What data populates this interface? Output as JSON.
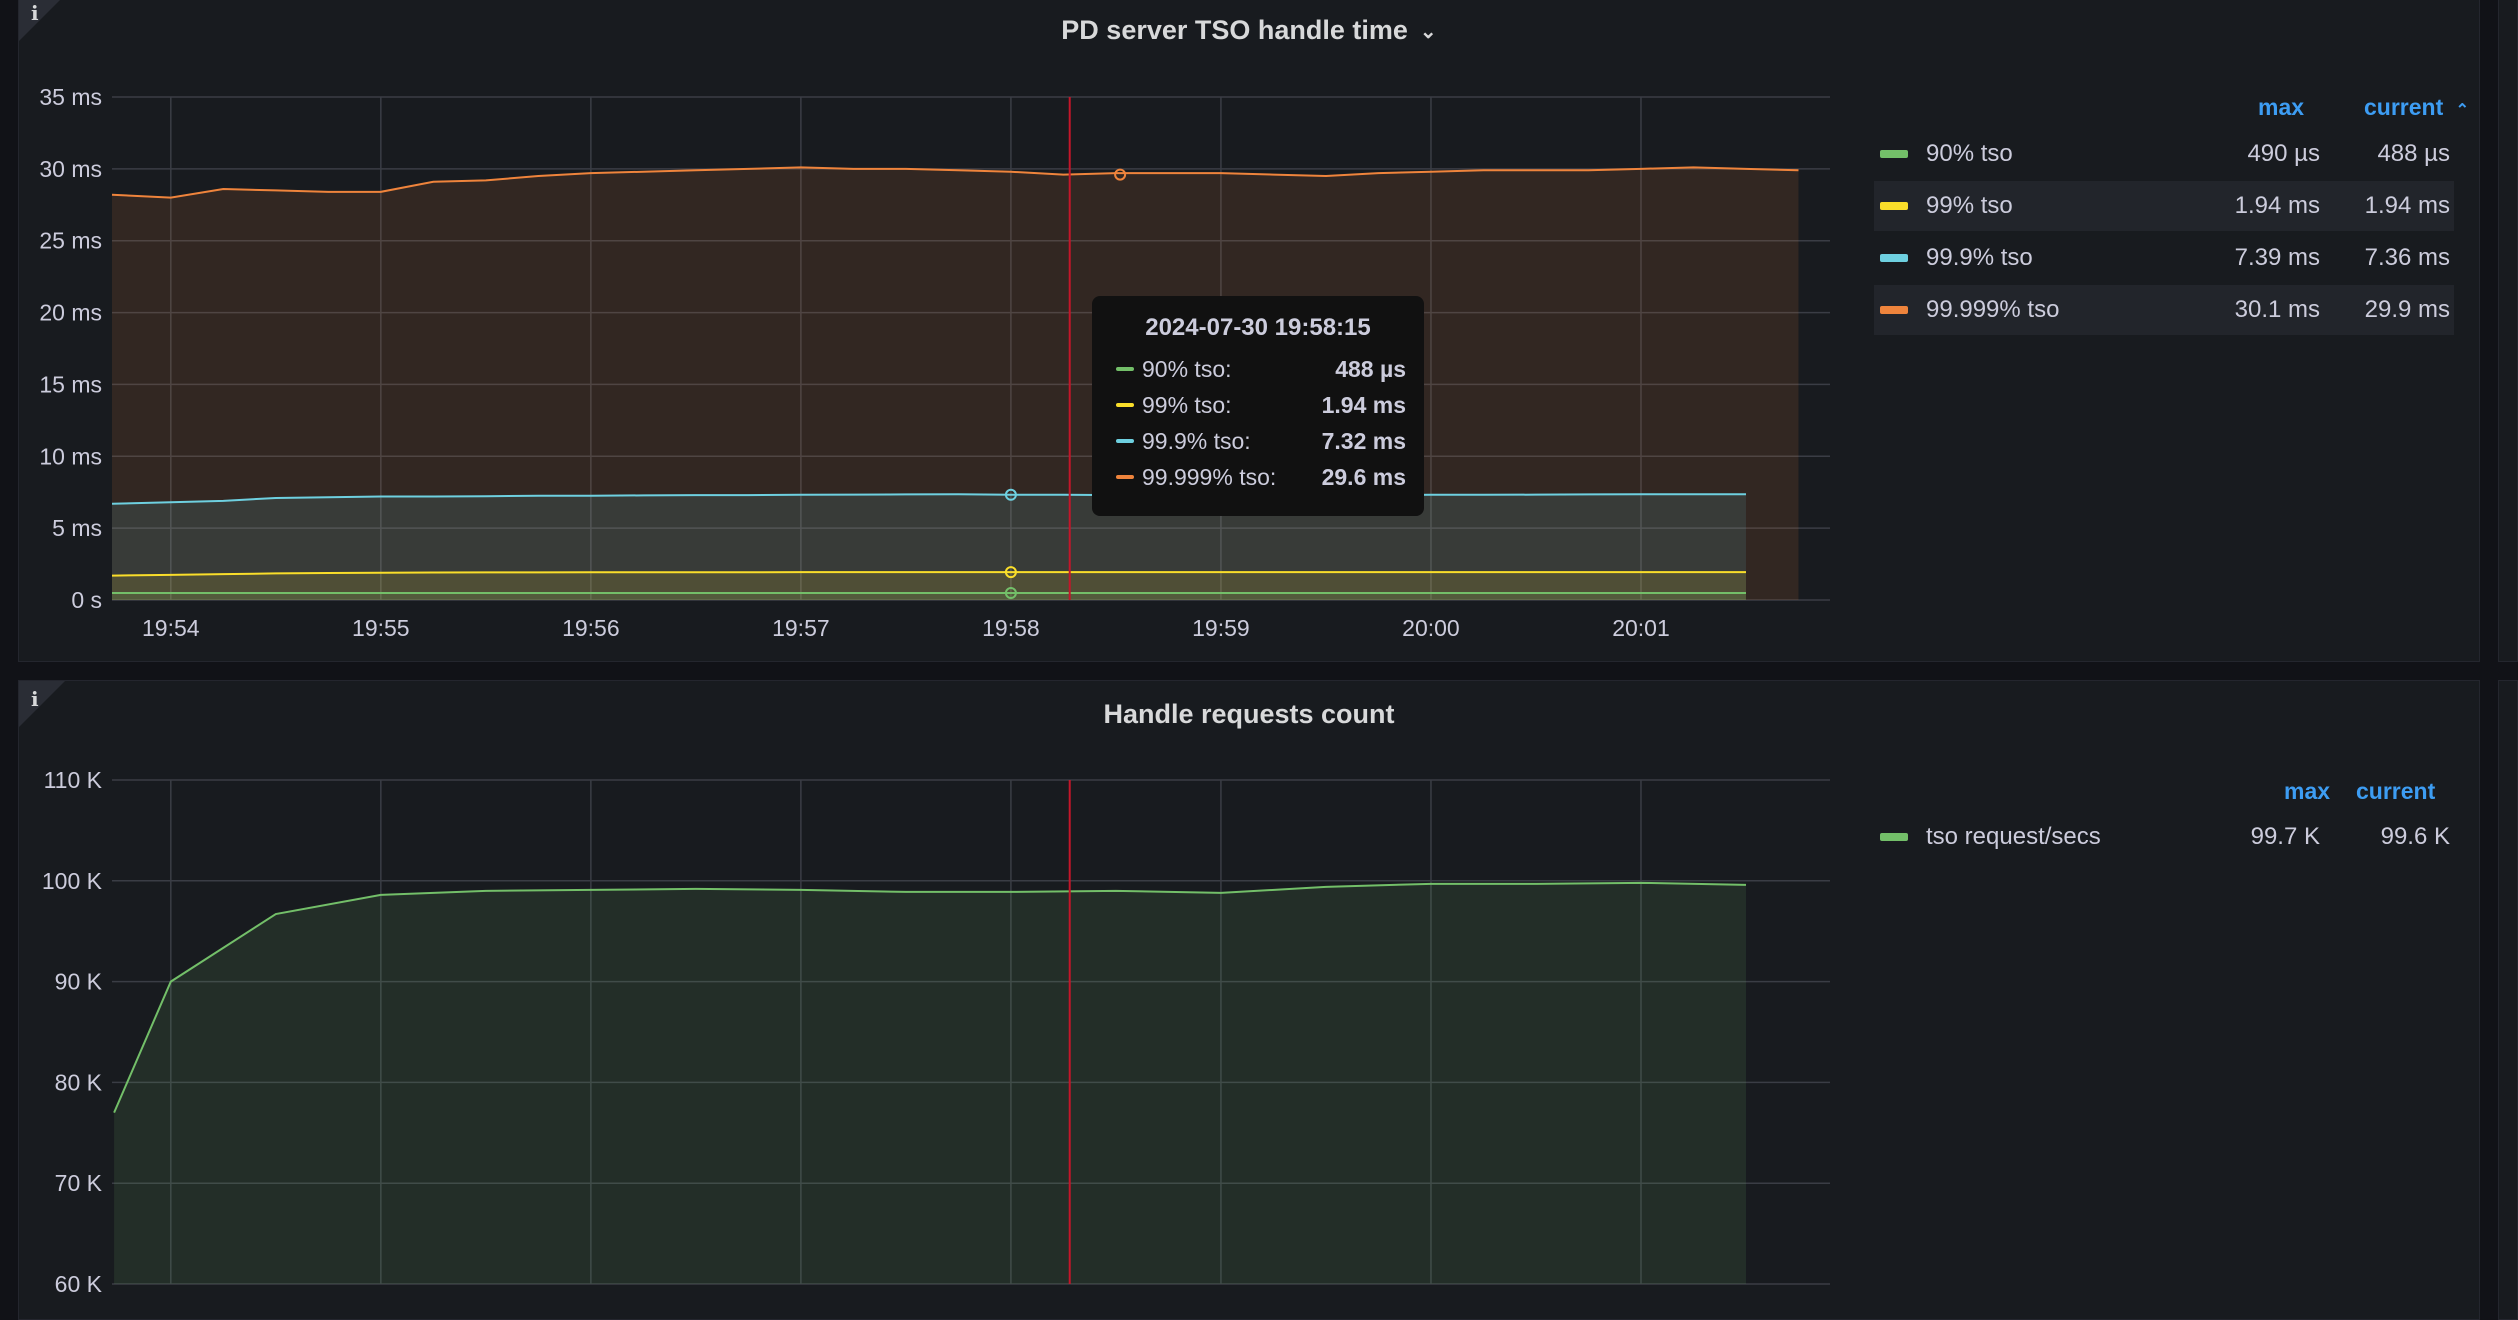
{
  "panel1": {
    "title": "PD server TSO handle time",
    "info_icon": "i",
    "legend": {
      "max_label": "max",
      "current_label": "current",
      "rows": [
        {
          "name": "90% tso",
          "max": "490 µs",
          "current": "488 µs",
          "color": "#73bf69"
        },
        {
          "name": "99% tso",
          "max": "1.94 ms",
          "current": "1.94 ms",
          "color": "#fade2a"
        },
        {
          "name": "99.9% tso",
          "max": "7.39 ms",
          "current": "7.36 ms",
          "color": "#6ed0e0"
        },
        {
          "name": "99.999% tso",
          "max": "30.1 ms",
          "current": "29.9 ms",
          "color": "#ef843c"
        }
      ]
    },
    "tooltip": {
      "time": "2024-07-30 19:58:15",
      "rows": [
        {
          "label": "90% tso:",
          "value": "488 µs",
          "color": "#73bf69"
        },
        {
          "label": "99% tso:",
          "value": "1.94 ms",
          "color": "#fade2a"
        },
        {
          "label": "99.9% tso:",
          "value": "7.32 ms",
          "color": "#6ed0e0"
        },
        {
          "label": "99.999% tso:",
          "value": "29.6 ms",
          "color": "#ef843c"
        }
      ]
    }
  },
  "panel2": {
    "title": "Handle requests count",
    "info_icon": "i",
    "legend": {
      "max_label": "max",
      "current_label": "current",
      "rows": [
        {
          "name": "tso request/secs",
          "max": "99.7 K",
          "current": "99.6 K",
          "color": "#73bf69"
        }
      ]
    }
  },
  "chart_data": [
    {
      "type": "area",
      "title": "PD server TSO handle time",
      "ylim": [
        0,
        35
      ],
      "y_ticks": [
        "35 ms",
        "30 ms",
        "25 ms",
        "20 ms",
        "15 ms",
        "10 ms",
        "5 ms",
        "0 s"
      ],
      "y_tick_values": [
        35,
        30,
        25,
        20,
        15,
        10,
        5,
        0
      ],
      "x_ticks": [
        "19:54",
        "19:55",
        "19:56",
        "19:57",
        "19:58",
        "19:59",
        "20:00",
        "20:01"
      ],
      "x_tick_minutes": [
        0,
        1,
        2,
        3,
        4,
        5,
        6,
        7
      ],
      "xlim_minutes": [
        -0.28,
        7.9
      ],
      "cursor_minute": 4.28,
      "x_minutes": [
        -0.28,
        0,
        0.25,
        0.5,
        0.75,
        1,
        1.25,
        1.5,
        1.75,
        2,
        2.25,
        2.5,
        2.75,
        3,
        3.25,
        3.5,
        3.75,
        4,
        4.25,
        4.5,
        4.75,
        5,
        5.25,
        5.5,
        5.75,
        6,
        6.25,
        6.5,
        6.75,
        7,
        7.25,
        7.5,
        7.75
      ],
      "series": [
        {
          "name": "90% tso",
          "color": "#73bf69",
          "values": [
            0.49,
            0.49,
            0.49,
            0.49,
            0.49,
            0.49,
            0.49,
            0.49,
            0.49,
            0.49,
            0.49,
            0.49,
            0.49,
            0.49,
            0.49,
            0.49,
            0.49,
            0.488,
            0.488,
            0.488,
            0.488,
            0.488,
            0.488,
            0.488,
            0.488,
            0.488,
            0.488,
            0.488,
            0.488,
            0.488,
            0.488,
            0.488,
            null
          ]
        },
        {
          "name": "99% tso",
          "color": "#fade2a",
          "values": [
            1.7,
            1.75,
            1.8,
            1.85,
            1.88,
            1.9,
            1.91,
            1.92,
            1.92,
            1.93,
            1.93,
            1.93,
            1.93,
            1.94,
            1.94,
            1.94,
            1.94,
            1.94,
            1.94,
            1.94,
            1.94,
            1.94,
            1.94,
            1.94,
            1.94,
            1.94,
            1.94,
            1.94,
            1.94,
            1.94,
            1.94,
            1.94,
            null
          ]
        },
        {
          "name": "99.9% tso",
          "color": "#6ed0e0",
          "values": [
            6.7,
            6.8,
            6.9,
            7.1,
            7.15,
            7.2,
            7.2,
            7.22,
            7.25,
            7.25,
            7.28,
            7.3,
            7.3,
            7.32,
            7.33,
            7.35,
            7.36,
            7.32,
            7.32,
            7.3,
            7.3,
            7.3,
            7.28,
            7.3,
            7.3,
            7.32,
            7.32,
            7.33,
            7.35,
            7.36,
            7.36,
            7.36,
            null
          ]
        },
        {
          "name": "99.999% tso",
          "color": "#ef843c",
          "values": [
            28.2,
            28.0,
            28.6,
            28.5,
            28.4,
            28.4,
            29.1,
            29.2,
            29.5,
            29.7,
            29.8,
            29.9,
            30.0,
            30.1,
            30.0,
            30.0,
            29.9,
            29.8,
            29.6,
            29.7,
            29.7,
            29.7,
            29.6,
            29.5,
            29.7,
            29.8,
            29.9,
            29.9,
            29.9,
            30.0,
            30.1,
            30.0,
            29.9
          ]
        }
      ]
    },
    {
      "type": "area",
      "title": "Handle requests count",
      "ylim": [
        60,
        110
      ],
      "y_ticks": [
        "110 K",
        "100 K",
        "90 K",
        "80 K",
        "70 K",
        "60 K"
      ],
      "y_tick_values": [
        110,
        100,
        90,
        80,
        70,
        60
      ],
      "x_tick_minutes": [
        0,
        1,
        2,
        3,
        4,
        5,
        6,
        7
      ],
      "xlim_minutes": [
        -0.28,
        7.9
      ],
      "cursor_minute": 4.28,
      "x_minutes": [
        -0.27,
        0,
        0.5,
        1,
        1.5,
        2,
        2.5,
        3,
        3.5,
        4,
        4.5,
        5,
        5.5,
        6,
        6.5,
        7,
        7.5
      ],
      "series": [
        {
          "name": "tso request/secs",
          "color": "#73bf69",
          "values": [
            77,
            90,
            96.7,
            98.6,
            99.0,
            99.1,
            99.2,
            99.1,
            98.9,
            98.9,
            99.0,
            98.8,
            99.4,
            99.7,
            99.7,
            99.8,
            99.6
          ]
        }
      ]
    }
  ]
}
